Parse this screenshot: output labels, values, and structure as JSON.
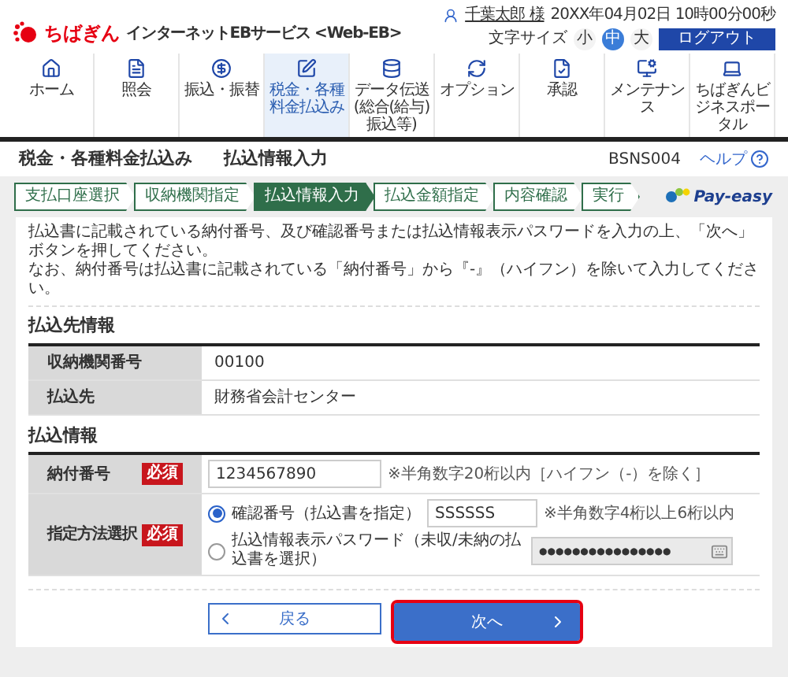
{
  "header": {
    "logo": "ちばぎん",
    "service": "インターネットEBサービス <Web-EB>",
    "user": "千葉太郎 様",
    "datetime": "20XX年04月02日 10時00分00秒",
    "font_size_label": "文字サイズ",
    "logout": "ログアウト",
    "font_sizes": [
      {
        "label": "小",
        "selected": false
      },
      {
        "label": "中",
        "selected": true
      },
      {
        "label": "大",
        "selected": false
      }
    ]
  },
  "nav": [
    {
      "kind": "home",
      "label": "ホーム",
      "selected": false
    },
    {
      "kind": "inquiry",
      "label": "照会",
      "selected": false
    },
    {
      "kind": "transfer",
      "label": "振込・振替",
      "selected": false
    },
    {
      "kind": "tax",
      "label": "税金・各種料金払込み",
      "selected": true
    },
    {
      "kind": "data",
      "label": "データ伝送",
      "sub": "(総合(給与)振込等)",
      "selected": false
    },
    {
      "kind": "option",
      "label": "オプション",
      "selected": false
    },
    {
      "kind": "approval",
      "label": "承認",
      "selected": false
    },
    {
      "kind": "maintenance",
      "label": "メンテナンス",
      "selected": false
    },
    {
      "kind": "portal",
      "label": "ちばぎんビジネスポータル",
      "selected": false
    }
  ],
  "page": {
    "title": "税金・各種料金払込み",
    "subtitle": "払込情報入力",
    "screen_id": "BSNS004",
    "help": "ヘルプ"
  },
  "steps": [
    {
      "label": "支払口座選択",
      "selected": false
    },
    {
      "label": "収納機関指定",
      "selected": false
    },
    {
      "label": "払込情報入力",
      "selected": true
    },
    {
      "label": "払込金額指定",
      "selected": false
    },
    {
      "label": "内容確認",
      "selected": false
    },
    {
      "label": "実行",
      "selected": false
    }
  ],
  "payeasy_logo": "Pay-easy",
  "instructions": [
    "払込書に記載されている納付番号、及び確認番号または払込情報表示パスワードを入力の上、「次へ」ボタンを押してください。",
    "なお、納付番号は払込書に記載されている「納付番号」から『-』（ハイフン）を除いて入力してください。"
  ],
  "payee": {
    "title": "払込先情報",
    "rows": [
      {
        "label": "収納機関番号",
        "value": "00100"
      },
      {
        "label": "払込先",
        "value": "財務省会計センター"
      }
    ]
  },
  "payment": {
    "title": "払込情報",
    "number": {
      "label": "納付番号",
      "required": "必須",
      "value": "1234567890",
      "note": "※半角数字20桁以内［ハイフン（-）を除く］"
    },
    "method": {
      "label": "指定方法選択",
      "required": "必須",
      "options": [
        {
          "label": "確認番号（払込書を指定）",
          "selected": true,
          "value": "SSSSSS",
          "note": "※半角数字4桁以上6桁以内"
        },
        {
          "label": "払込情報表示パスワード（未収/未納の払込書を選択）",
          "selected": false,
          "value": "●●●●●●●●●●●●●●●●"
        }
      ]
    }
  },
  "buttons": {
    "back": "戻る",
    "next": "次へ",
    "next_highlighted": true
  }
}
